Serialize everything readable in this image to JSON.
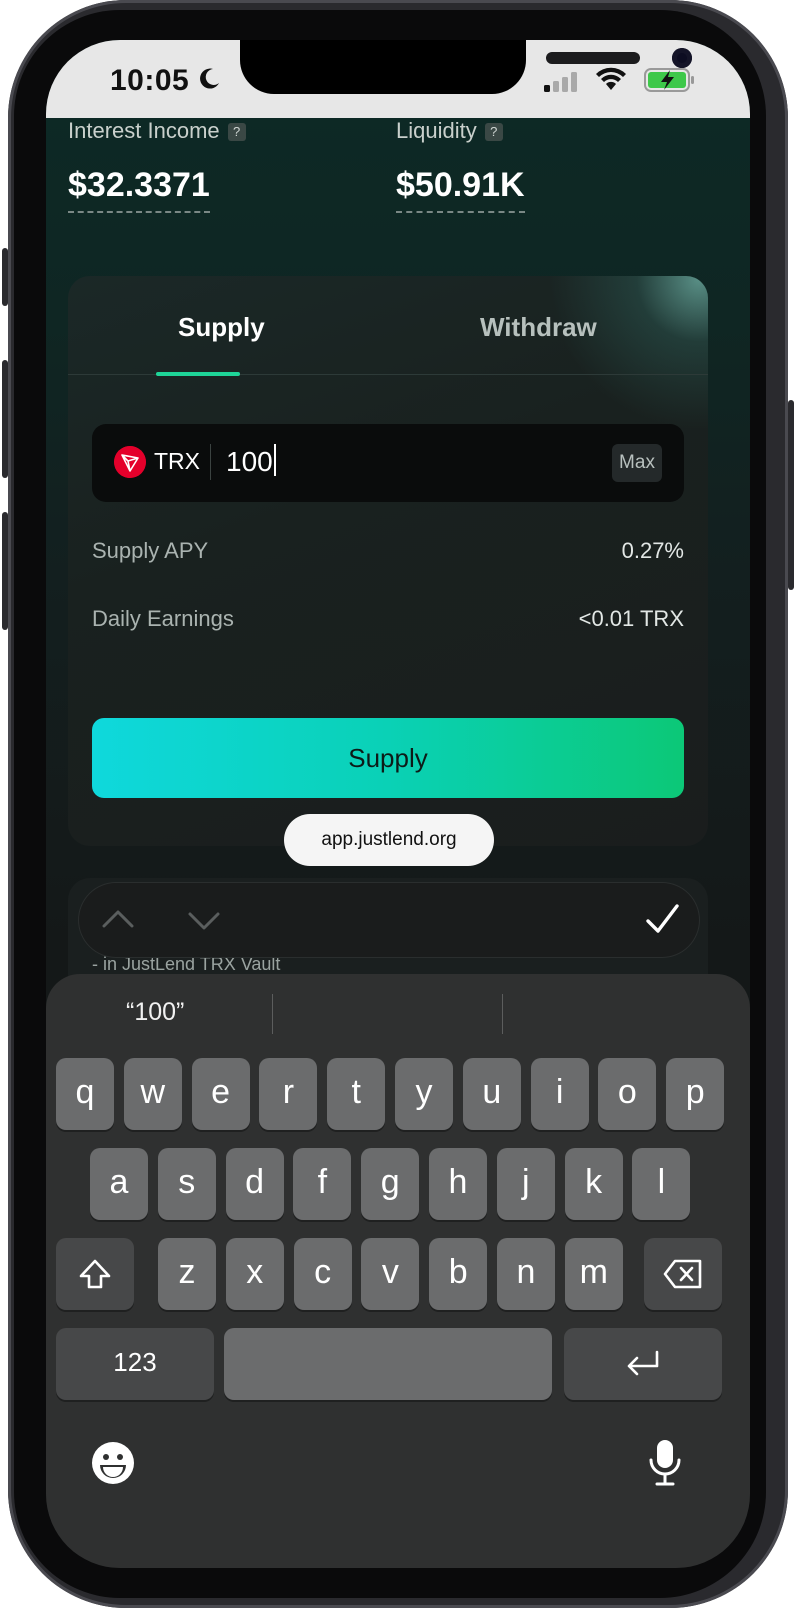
{
  "status_bar": {
    "time": "10:05"
  },
  "stats": {
    "interest_income": {
      "label": "Interest Income",
      "help": "?",
      "value": "$32.3371"
    },
    "liquidity": {
      "label": "Liquidity",
      "help": "?",
      "value": "$50.91K"
    }
  },
  "tabs": {
    "supply": "Supply",
    "withdraw": "Withdraw",
    "active": "Supply"
  },
  "amount": {
    "token": "TRX",
    "value": "100",
    "max_label": "Max"
  },
  "details": [
    {
      "label": "Supply APY",
      "value": "0.27%"
    },
    {
      "label": "Daily Earnings",
      "value": "<0.01 TRX"
    }
  ],
  "supply_button": "Supply",
  "browser": {
    "url": "app.justlend.org"
  },
  "vault_note": "- in JustLend TRX Vault",
  "keyboard": {
    "suggestions": [
      "“100”",
      "",
      ""
    ],
    "row1": [
      "q",
      "w",
      "e",
      "r",
      "t",
      "y",
      "u",
      "i",
      "o",
      "p"
    ],
    "row2": [
      "a",
      "s",
      "d",
      "f",
      "g",
      "h",
      "j",
      "k",
      "l"
    ],
    "row3": [
      "z",
      "x",
      "c",
      "v",
      "b",
      "n",
      "m"
    ],
    "numbers_key": "123",
    "icons": {
      "shift": "shift-icon",
      "backspace": "backspace-icon",
      "return": "return-icon",
      "emoji": "emoji-icon",
      "mic": "microphone-icon",
      "checkmark": "checkmark-icon"
    }
  },
  "colors": {
    "accent": "#1ed598",
    "button_start": "#0fd8dc",
    "button_end": "#0cc877",
    "trx_red": "#e4002b"
  }
}
